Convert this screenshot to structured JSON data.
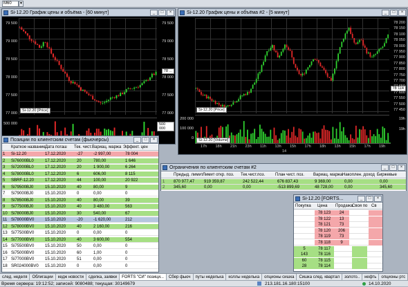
{
  "toolbar": {
    "combo": "M60",
    "arrow": "▼"
  },
  "chart1": {
    "title": "Si-12.20 График цены и объёма - [60 минут]",
    "legend_price": "Si-12.20 [Price]",
    "price_pill": "78 ...",
    "price_ticks": [
      "79 500",
      "79 000",
      "78 500",
      "78 000",
      "77 500",
      "77 000"
    ],
    "vol_ticks": [
      "500 000",
      "0"
    ],
    "vol_pill": "500 000",
    "window_buttons": [
      "_",
      "□",
      "×"
    ]
  },
  "chart2": {
    "title": "Si-12.20 График цены и объёма #2 - [5 минут]",
    "legend_price": "Si-12.20 [Price]",
    "legend_vol": "Si-12.20 [Volume]",
    "price_ticks": [
      "78 200",
      "78 150",
      "78 100",
      "78 050",
      "78 000",
      "77 950",
      "77 900",
      "77 850",
      "77 800",
      "77 750",
      "77 700",
      "77 650",
      "77 600",
      "77 550",
      "77 500",
      "77 450"
    ],
    "price_pill": "78 114",
    "vol_ticks_left": [
      "200 000",
      "100 000",
      "0"
    ],
    "vol_ticks_right": [
      "19h",
      "19h"
    ],
    "x_labels": [
      "17h",
      "18h",
      "21h",
      "23h",
      "11h",
      "13h",
      "15h",
      "17h",
      "18h",
      "13h",
      "15h",
      "17h",
      "19h"
    ],
    "date_label": "14",
    "window_buttons": [
      "_",
      "□",
      "×"
    ]
  },
  "chart_data": [
    {
      "type": "candlestick",
      "title": "Si-12.20 График цены и объёма - [60 минут]",
      "series": [
        {
          "name": "Si-12.20 [Price]"
        }
      ],
      "ylim": [
        77000,
        79600
      ],
      "close_path": [
        79350,
        79200,
        79050,
        78950,
        78800,
        79000,
        78700,
        78500,
        78300,
        78100,
        77900,
        77850,
        77700,
        77600,
        77500,
        77400,
        77300,
        77350,
        77450,
        77500,
        77550,
        77650,
        77700,
        77750,
        77800,
        77900,
        78050,
        78114
      ]
    },
    {
      "type": "candlestick",
      "title": "Si-12.20 График цены и объёма #2 - [5 минут]",
      "series": [
        {
          "name": "Si-12.20 [Price]"
        },
        {
          "name": "Si-12.20 [Volume]"
        }
      ],
      "ylim": [
        77450,
        78220
      ],
      "close_path": [
        77650,
        77600,
        77580,
        77550,
        77520,
        77500,
        77530,
        77560,
        77600,
        77620,
        77700,
        77800,
        77950,
        78000,
        77900,
        78000,
        77950,
        77800,
        77750,
        77820,
        77900,
        77850,
        77780,
        77700,
        77900,
        78050,
        78150,
        78000,
        78050,
        77950,
        77900,
        77950,
        78000,
        78114
      ]
    }
  ],
  "positions": {
    "title": "Позиции по клиентским счетам (фьючерсы)",
    "headers": [
      "Краткое название",
      "Дата погаш",
      "Тек. чист.",
      "Вариац. маржа",
      "Эффект. цен"
    ],
    "rows": [
      {
        "n": "1",
        "name": "Si-12.20",
        "date": "17.12.2020",
        "net": "-27",
        "var": "-2 997,00",
        "eff": "78 004",
        "color": "pink"
      },
      {
        "n": "2",
        "name": "Si76000BL0",
        "date": "17.12.2020",
        "net": "20",
        "var": "780,00",
        "eff": "1 646",
        "color": "green"
      },
      {
        "n": "3",
        "name": "Si72000BL0",
        "date": "17.12.2020",
        "net": "20",
        "var": "1 900,00",
        "eff": "6 264",
        "color": "green"
      },
      {
        "n": "4",
        "name": "Si78000BL0",
        "date": "17.12.2020",
        "net": "6",
        "var": "606,00",
        "eff": "8 115",
        "color": "green"
      },
      {
        "n": "5",
        "name": "SBRF-12.20",
        "date": "17.12.2020",
        "net": "44",
        "var": "100,00",
        "eff": "20 922",
        "color": "green"
      },
      {
        "n": "6",
        "name": "Si79500BJ0",
        "date": "15.10.2020",
        "net": "40",
        "var": "80,00",
        "eff": "9",
        "color": "green"
      },
      {
        "n": "7",
        "name": "Si79000BJ0",
        "date": "15.10.2020",
        "net": "0",
        "var": "0,00",
        "eff": "0",
        "color": "white"
      },
      {
        "n": "8",
        "name": "Si78500BJ0",
        "date": "15.10.2020",
        "net": "40",
        "var": "80,00",
        "eff": "39",
        "color": "green"
      },
      {
        "n": "9",
        "name": "Si77500BJ0",
        "date": "15.10.2020",
        "net": "40",
        "var": "3 480,00",
        "eff": "563",
        "color": "green"
      },
      {
        "n": "10",
        "name": "Si78000BJ0",
        "date": "15.10.2020",
        "net": "30",
        "var": "540,00",
        "eff": "67",
        "color": "green"
      },
      {
        "n": "11",
        "name": "Si78000BV0",
        "date": "15.10.2020",
        "net": "-20",
        "var": "-1 620,00",
        "eff": "212",
        "color": "pink"
      },
      {
        "n": "12",
        "name": "Si78000BV0",
        "date": "15.10.2020",
        "net": "40",
        "var": "2 160,00",
        "eff": "216",
        "color": "green"
      },
      {
        "n": "13",
        "name": "Si77500BV0",
        "date": "15.10.2020",
        "net": "0",
        "var": "0,00",
        "eff": "0",
        "color": "white"
      },
      {
        "n": "14",
        "name": "Si77000BV0",
        "date": "15.10.2020",
        "net": "40",
        "var": "3 600,00",
        "eff": "554",
        "color": "green"
      },
      {
        "n": "15",
        "name": "Si75500BV0",
        "date": "15.10.2020",
        "net": "50",
        "var": "0,00",
        "eff": "0",
        "color": "white"
      },
      {
        "n": "16",
        "name": "Si75000BV0",
        "date": "15.10.2020",
        "net": "60",
        "var": "1,00",
        "eff": "0",
        "color": "white"
      },
      {
        "n": "17",
        "name": "Si77000BV0",
        "date": "15.10.2020",
        "net": "51",
        "var": "0,00",
        "eff": "0",
        "color": "white"
      },
      {
        "n": "18",
        "name": "SR024000BV0",
        "date": "15.10.2020",
        "net": "0",
        "var": "0,00",
        "eff": "0",
        "color": "white"
      }
    ]
  },
  "limits": {
    "title": "Ограничения по клиентским счетам #2",
    "headers": [
      "Предыд. лимит",
      "Лимит откр. поз.",
      "Тек.чист.поз.",
      "План чист. поз.",
      "Вариац. маржа",
      "Накоплен. доход",
      "Биржевые"
    ],
    "rows": [
      {
        "n": "1",
        "cells": [
          "870 977,47",
          "919 359,87",
          "242 522,44",
          "676 837,43",
          "9 369,00",
          "0,00",
          "0,00"
        ]
      },
      {
        "n": "2",
        "cells": [
          "345,60",
          "0,00",
          "0,00",
          "-513 899,69",
          "48 728,00",
          "0,00",
          "345,60"
        ]
      }
    ]
  },
  "orderbook": {
    "title": "Si-12.20 [FORTS...",
    "headers": [
      "Покупка",
      "Цена",
      "Продажа",
      "Своя по",
      "Св"
    ],
    "rows": [
      {
        "buy": "",
        "price": "78 123",
        "sell": "24",
        "side": "ask"
      },
      {
        "buy": "",
        "price": "78 122",
        "sell": "13",
        "side": "ask"
      },
      {
        "buy": "",
        "price": "78 121",
        "sell": "73",
        "side": "ask"
      },
      {
        "buy": "",
        "price": "78 120",
        "sell": "206",
        "side": "ask"
      },
      {
        "buy": "",
        "price": "78 119",
        "sell": "73",
        "side": "ask"
      },
      {
        "buy": "",
        "price": "78 118",
        "sell": "9",
        "side": "ask"
      },
      {
        "buy": "5",
        "price": "78 117",
        "sell": "",
        "side": "bid"
      },
      {
        "buy": "143",
        "price": "78 116",
        "sell": "",
        "side": "bid"
      },
      {
        "buy": "60",
        "price": "78 115",
        "sell": "",
        "side": "bid"
      },
      {
        "buy": "28",
        "price": "78 114",
        "sell": "",
        "side": "bid"
      }
    ]
  },
  "tabs": [
    "след. неделя",
    "Облигации",
    "кедж новости",
    "сделка, заявки",
    "FORTS \"СИ\" позици...",
    "Сбер фьюч",
    "путы неделька",
    "коллы неделька",
    "опционы сишка",
    "Сишка след. квартал",
    "золото..",
    "нефть",
    "опционы ртс",
    "яндекс"
  ],
  "status": {
    "server_time": "Время сервера: 19:12:52; записей: 9080488; текущая: 30149679",
    "ip": "213.181.16.180:15100",
    "date": "14.10.2020"
  }
}
